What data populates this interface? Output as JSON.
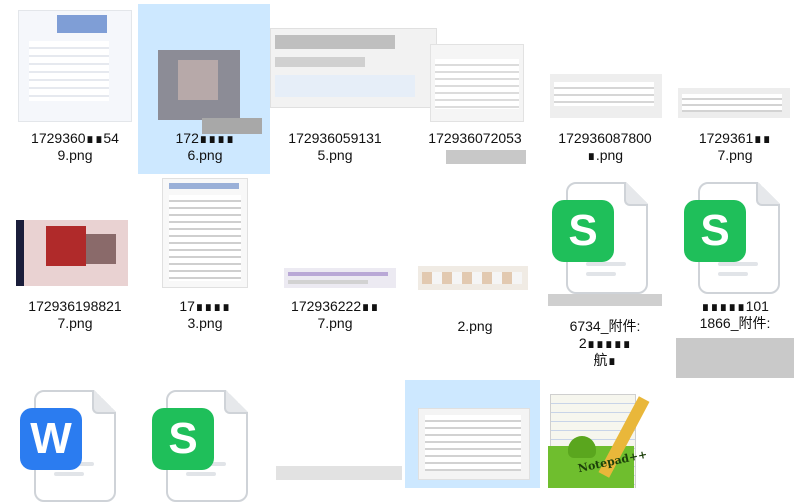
{
  "files": [
    {
      "id": "f1",
      "label": "1729360∎∎54\n9.png"
    },
    {
      "id": "f2",
      "label": "172∎∎∎∎\n6.png"
    },
    {
      "id": "f3",
      "label": "172936059131\n5.png"
    },
    {
      "id": "f4",
      "label": "172936072053"
    },
    {
      "id": "f5",
      "label": "172936087800\n∎.png"
    },
    {
      "id": "f6",
      "label": "1729361∎∎\n7.png"
    },
    {
      "id": "f7",
      "label": "172936198821\n7.png"
    },
    {
      "id": "f8",
      "label": "17∎∎∎∎\n3.png"
    },
    {
      "id": "f9",
      "label": "172936222∎∎\n7.png"
    },
    {
      "id": "f10",
      "label": "2.png"
    },
    {
      "id": "f11",
      "label": "6734_附件:\n2∎∎∎∎∎\n航∎",
      "icon": "S"
    },
    {
      "id": "f12",
      "label": "∎∎∎∎∎101\n1866_附件:",
      "icon": "S"
    },
    {
      "id": "f13",
      "label": "",
      "icon": "W"
    },
    {
      "id": "f14",
      "label": "",
      "icon": "S"
    },
    {
      "id": "f15",
      "label": ""
    },
    {
      "id": "f16",
      "label": "",
      "app": "Notepad++"
    }
  ],
  "colors": {
    "selection": "#cde8ff",
    "wps_sheet": "#1fbf5a",
    "wps_writer": "#2b7cf0"
  }
}
